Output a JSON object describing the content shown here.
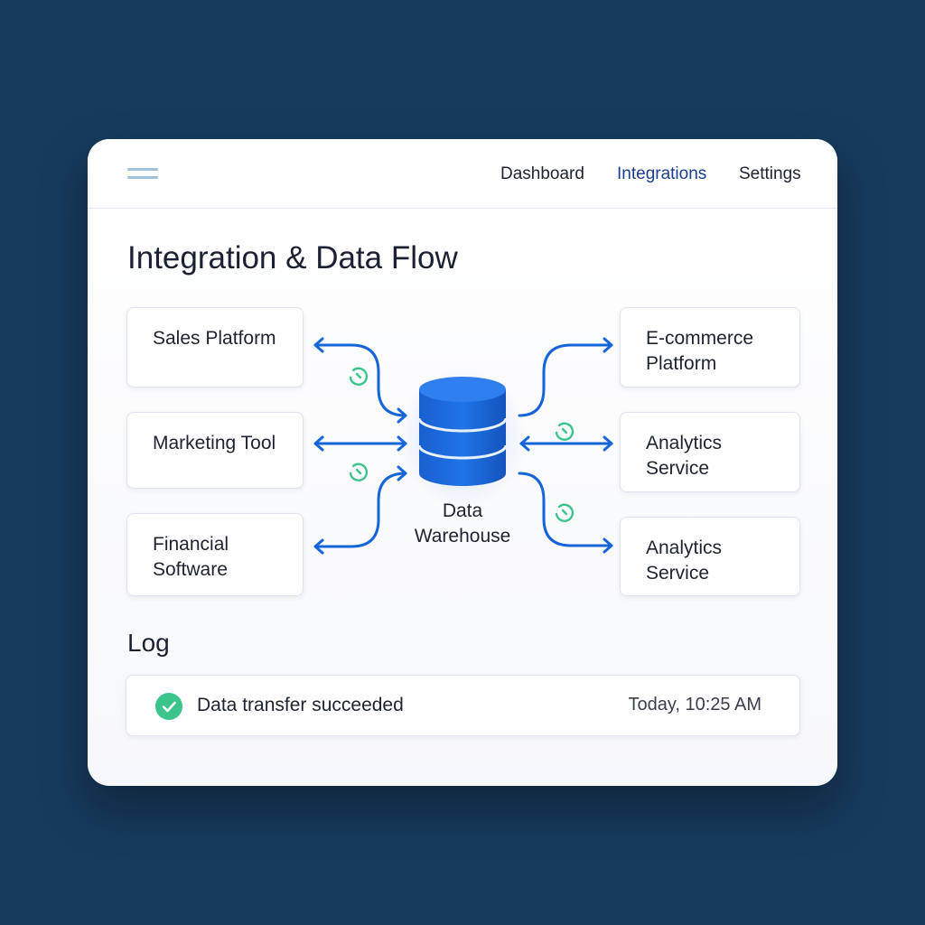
{
  "nav": {
    "menu_icon": "hamburger-icon",
    "items": [
      "Dashboard",
      "Integrations",
      "Settings"
    ],
    "active": "Integrations"
  },
  "page": {
    "title": "Integration & Data Flow"
  },
  "sources": [
    {
      "lines": [
        "Sales Platform"
      ]
    },
    {
      "lines": [
        "Marketing Tool"
      ]
    },
    {
      "lines": [
        "Financial",
        "Software"
      ]
    }
  ],
  "destinations": [
    {
      "lines": [
        "E-commerce",
        "Platform"
      ]
    },
    {
      "lines": [
        "Analytics",
        "Service"
      ]
    },
    {
      "lines": [
        "Analytics",
        "Service"
      ]
    }
  ],
  "hub": {
    "lines": [
      "Data",
      "Warehouse"
    ],
    "icon": "database-icon"
  },
  "log": {
    "title": "Log",
    "entry": {
      "status_icon": "check-circle-icon",
      "message": "Data transfer succeeded",
      "time": "Today, 10:25 AM"
    }
  },
  "colors": {
    "background": "#173a5c",
    "accent": "#1565d8",
    "sync": "#3cc48d",
    "active_nav": "#1b3d8f"
  }
}
